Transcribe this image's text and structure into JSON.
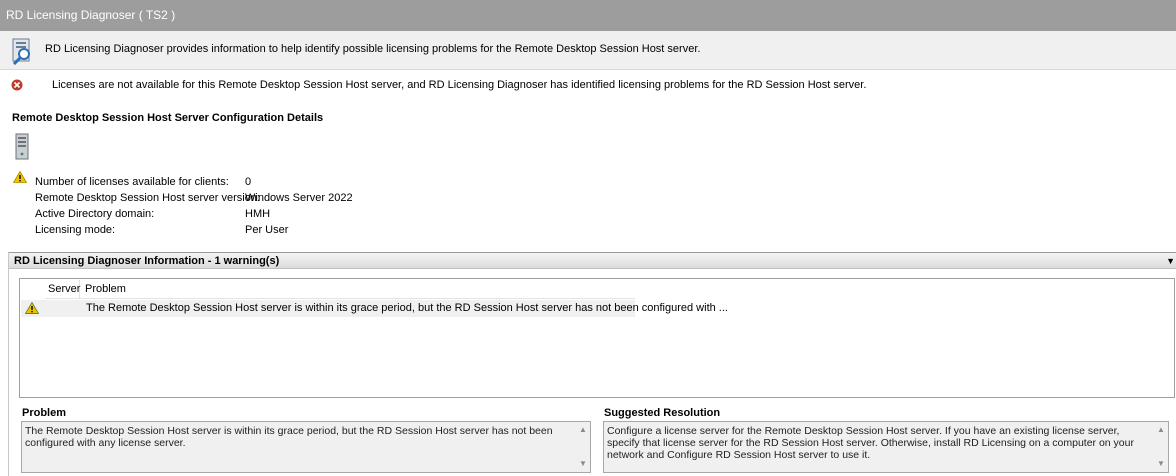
{
  "window": {
    "title": "RD Licensing Diagnoser ( TS2 )"
  },
  "infobar": {
    "text": "RD Licensing Diagnoser provides information to help identify possible licensing problems for the Remote Desktop Session Host server."
  },
  "error": {
    "text": "Licenses are not available for this Remote Desktop Session Host server, and RD Licensing Diagnoser has identified licensing problems for the RD Session Host server."
  },
  "config": {
    "title": "Remote Desktop Session Host Server Configuration Details",
    "rows": [
      {
        "label": "Number of licenses available for clients:",
        "value": "0"
      },
      {
        "label": "Remote Desktop Session Host server version:",
        "value": "Windows Server 2022"
      },
      {
        "label": "Active Directory domain:",
        "value": "HMH"
      },
      {
        "label": "Licensing mode:",
        "value": "Per User"
      }
    ]
  },
  "diagnoser": {
    "header": "RD Licensing Diagnoser Information - 1 warning(s)",
    "columns": {
      "server": "Server",
      "problem": "Problem"
    },
    "rows": [
      {
        "server": "",
        "problem": "The Remote Desktop Session Host server is within its grace period, but the RD Session Host server has not been configured with ..."
      }
    ]
  },
  "problem_pane": {
    "title": "Problem",
    "text": "The Remote Desktop Session Host server is within its grace period, but the RD Session Host server has not been configured with any license server."
  },
  "resolution_pane": {
    "title": "Suggested Resolution",
    "text": "Configure a license server for the Remote Desktop Session Host server. If you have an existing license server, specify that license server for the RD Session Host server. Otherwise, install RD Licensing on a computer on your network and Configure RD Session Host server to use it."
  },
  "colors": {
    "titlebar": "#9d9d9d",
    "error": "#c0392b",
    "warning": "#f2c200"
  }
}
